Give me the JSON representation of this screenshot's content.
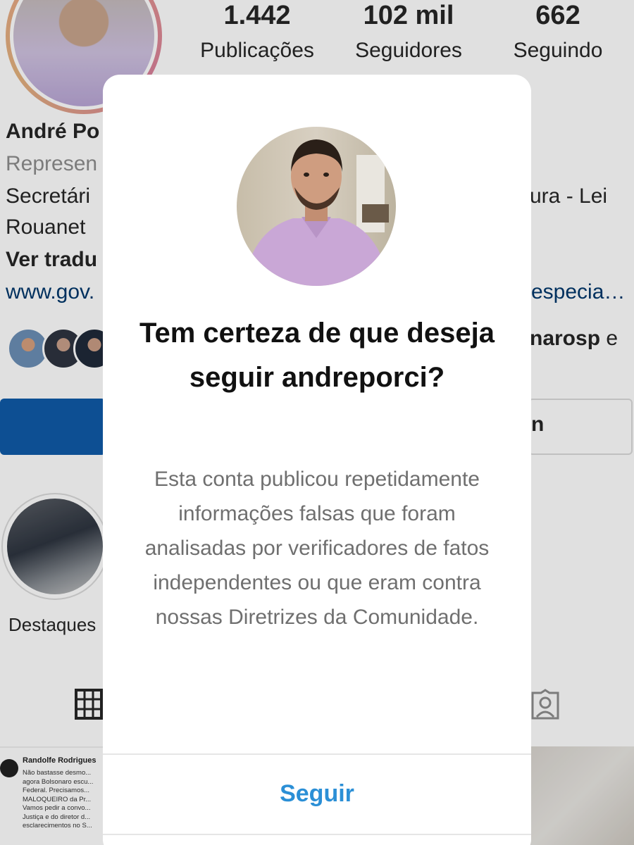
{
  "profile": {
    "stats": [
      {
        "value": "1.442",
        "label": "Publicações"
      },
      {
        "value": "102 mil",
        "label": "Seguidores"
      },
      {
        "value": "662",
        "label": "Seguindo"
      }
    ],
    "name_partial": "André Po",
    "category_partial": "Represen",
    "bio_line1_left": "Secretári",
    "bio_line1_right": "ura - Lei",
    "bio_line2": "Rouanet",
    "translate_partial": "Ver tradu",
    "link_left": "www.gov.",
    "link_right": "especia…",
    "followed_by_partial": "narosp",
    "followed_by_suffix": "e",
    "message_button_partial": "n",
    "highlight_label": "Destaques",
    "post_author": "Randolfe Rodrigues",
    "post_text": "Não bastasse desmo... agora Bolsonaro escu... Federal. Precisamos... MALOQUEIRO da Pr... Vamos pedir a convo... Justiça e do diretor d... esclarecimentos no S..."
  },
  "dialog": {
    "title": "Tem certeza de que deseja seguir andreporci?",
    "message": "Esta conta publicou repetidamente informações falsas que foram analisadas por verificadores de fatos independentes ou que eram contra nossas Diretrizes da Comunidade.",
    "confirm_label": "Seguir"
  },
  "colors": {
    "accent_blue": "#2b8fd6",
    "follow_button": "#0f5aa8",
    "link": "#00376b"
  }
}
